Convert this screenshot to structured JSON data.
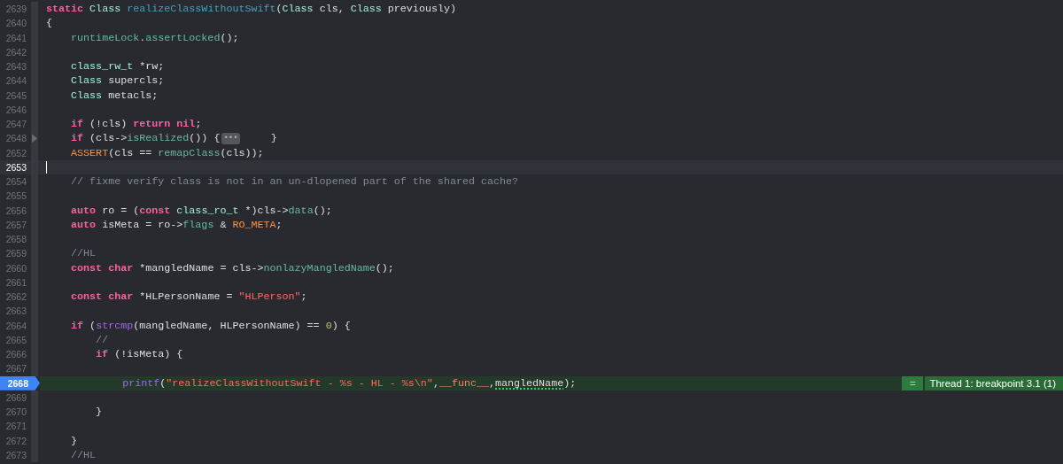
{
  "lines": [
    {
      "number": "2639",
      "current": false,
      "breakpoint": false,
      "folded": false,
      "tokens": [
        {
          "text": "static",
          "kind": "keyword"
        },
        {
          "text": " Class",
          "kind": "type"
        },
        {
          "text": " realizeClassWithoutSwift",
          "kind": "declaration"
        },
        {
          "text": "(",
          "kind": "plain"
        },
        {
          "text": "Class",
          "kind": "type"
        },
        {
          "text": " cls,",
          "kind": "plain"
        },
        {
          "text": " Class",
          "kind": "type"
        },
        {
          "text": " previously)",
          "kind": "plain"
        }
      ]
    },
    {
      "number": "2640",
      "current": false,
      "breakpoint": false,
      "folded": false,
      "tokens": [
        {
          "text": "{",
          "kind": "plain"
        }
      ]
    },
    {
      "number": "2641",
      "current": false,
      "breakpoint": false,
      "folded": false,
      "tokens": [
        {
          "text": "    runtimeLock",
          "kind": "function"
        },
        {
          "text": ".",
          "kind": "plain"
        },
        {
          "text": "assertLocked",
          "kind": "function"
        },
        {
          "text": "();",
          "kind": "plain"
        }
      ]
    },
    {
      "number": "2642",
      "current": false,
      "breakpoint": false,
      "folded": false
    },
    {
      "number": "2643",
      "current": false,
      "breakpoint": false,
      "folded": false,
      "tokens": [
        {
          "text": "    class_rw_t",
          "kind": "type"
        },
        {
          "text": " *rw;",
          "kind": "plain"
        }
      ]
    },
    {
      "number": "2644",
      "current": false,
      "breakpoint": false,
      "folded": false,
      "tokens": [
        {
          "text": "    Class",
          "kind": "type"
        },
        {
          "text": " supercls;",
          "kind": "plain"
        }
      ]
    },
    {
      "number": "2645",
      "current": false,
      "breakpoint": false,
      "folded": false,
      "tokens": [
        {
          "text": "    Class",
          "kind": "type"
        },
        {
          "text": " metacls;",
          "kind": "plain"
        }
      ]
    },
    {
      "number": "2646",
      "current": false,
      "breakpoint": false,
      "folded": false
    },
    {
      "number": "2647",
      "current": false,
      "breakpoint": false,
      "folded": false,
      "tokens": [
        {
          "text": "    if",
          "kind": "keyword"
        },
        {
          "text": " (!cls)",
          "kind": "plain"
        },
        {
          "text": " return",
          "kind": "keyword"
        },
        {
          "text": " nil",
          "kind": "keyword"
        },
        {
          "text": ";",
          "kind": "plain"
        }
      ]
    },
    {
      "number": "2648",
      "current": false,
      "breakpoint": false,
      "folded": true,
      "tokens": [
        {
          "text": "    if",
          "kind": "keyword"
        },
        {
          "text": " (cls->",
          "kind": "plain"
        },
        {
          "text": "isRealized",
          "kind": "function"
        },
        {
          "text": "()) {",
          "kind": "plain"
        },
        {
          "text": "•••",
          "kind": "fold"
        },
        {
          "text": "     }",
          "kind": "plain"
        }
      ]
    },
    {
      "number": "2652",
      "current": false,
      "breakpoint": false,
      "folded": false,
      "tokens": [
        {
          "text": "    ASSERT",
          "kind": "macro"
        },
        {
          "text": "(cls ==",
          "kind": "plain"
        },
        {
          "text": " remapClass",
          "kind": "function"
        },
        {
          "text": "(cls));",
          "kind": "plain"
        }
      ]
    },
    {
      "number": "2653",
      "current": true,
      "breakpoint": false,
      "folded": false
    },
    {
      "number": "2654",
      "current": false,
      "breakpoint": false,
      "folded": false,
      "tokens": [
        {
          "text": "    // fixme verify class is not in an un-dlopened part of the shared cache?",
          "kind": "comment"
        }
      ]
    },
    {
      "number": "2655",
      "current": false,
      "breakpoint": false,
      "folded": false
    },
    {
      "number": "2656",
      "current": false,
      "breakpoint": false,
      "folded": false,
      "tokens": [
        {
          "text": "    auto",
          "kind": "keyword"
        },
        {
          "text": " ro = (",
          "kind": "plain"
        },
        {
          "text": "const",
          "kind": "keyword"
        },
        {
          "text": " class_ro_t",
          "kind": "type"
        },
        {
          "text": " *)cls->",
          "kind": "plain"
        },
        {
          "text": "data",
          "kind": "function"
        },
        {
          "text": "();",
          "kind": "plain"
        }
      ]
    },
    {
      "number": "2657",
      "current": false,
      "breakpoint": false,
      "folded": false,
      "tokens": [
        {
          "text": "    auto",
          "kind": "keyword"
        },
        {
          "text": " isMeta = ro->",
          "kind": "plain"
        },
        {
          "text": "flags",
          "kind": "function"
        },
        {
          "text": " &",
          "kind": "plain"
        },
        {
          "text": " RO_META",
          "kind": "macro"
        },
        {
          "text": ";",
          "kind": "plain"
        }
      ]
    },
    {
      "number": "2658",
      "current": false,
      "breakpoint": false,
      "folded": false
    },
    {
      "number": "2659",
      "current": false,
      "breakpoint": false,
      "folded": false,
      "tokens": [
        {
          "text": "    //HL",
          "kind": "comment"
        }
      ]
    },
    {
      "number": "2660",
      "current": false,
      "breakpoint": false,
      "folded": false,
      "tokens": [
        {
          "text": "    const",
          "kind": "keyword"
        },
        {
          "text": " char",
          "kind": "keyword"
        },
        {
          "text": " *mangledName = cls->",
          "kind": "plain"
        },
        {
          "text": "nonlazyMangledName",
          "kind": "function"
        },
        {
          "text": "();",
          "kind": "plain"
        }
      ]
    },
    {
      "number": "2661",
      "current": false,
      "breakpoint": false,
      "folded": false
    },
    {
      "number": "2662",
      "current": false,
      "breakpoint": false,
      "folded": false,
      "tokens": [
        {
          "text": "    const",
          "kind": "keyword"
        },
        {
          "text": " char",
          "kind": "keyword"
        },
        {
          "text": " *HLPersonName =",
          "kind": "plain"
        },
        {
          "text": " \"HLPerson\"",
          "kind": "string"
        },
        {
          "text": ";",
          "kind": "plain"
        }
      ]
    },
    {
      "number": "2663",
      "current": false,
      "breakpoint": false,
      "folded": false
    },
    {
      "number": "2664",
      "current": false,
      "breakpoint": false,
      "folded": false,
      "tokens": [
        {
          "text": "    if",
          "kind": "keyword"
        },
        {
          "text": " (",
          "kind": "plain"
        },
        {
          "text": "strcmp",
          "kind": "system"
        },
        {
          "text": "(mangledName, HLPersonName) ==",
          "kind": "plain"
        },
        {
          "text": " 0",
          "kind": "number"
        },
        {
          "text": ") {",
          "kind": "plain"
        }
      ]
    },
    {
      "number": "2665",
      "current": false,
      "breakpoint": false,
      "folded": false,
      "tokens": [
        {
          "text": "        //",
          "kind": "comment"
        }
      ]
    },
    {
      "number": "2666",
      "current": false,
      "breakpoint": false,
      "folded": false,
      "tokens": [
        {
          "text": "        if",
          "kind": "keyword"
        },
        {
          "text": " (!isMeta) {",
          "kind": "plain"
        }
      ]
    },
    {
      "number": "2667",
      "current": false,
      "breakpoint": false,
      "folded": false
    },
    {
      "number": "2668",
      "current": false,
      "breakpoint": true,
      "folded": false,
      "tokens": [
        {
          "text": "            printf",
          "kind": "system"
        },
        {
          "text": "(",
          "kind": "plain"
        },
        {
          "text": "\"realizeClassWithoutSwift - %s - HL - %s\\n\"",
          "kind": "string"
        },
        {
          "text": ",",
          "kind": "plain"
        },
        {
          "text": "__func__",
          "kind": "builtin"
        },
        {
          "text": ",",
          "kind": "plain"
        },
        {
          "text": "mangledName",
          "kind": "plain",
          "underline": true
        },
        {
          "text": ");",
          "kind": "plain"
        }
      ],
      "annotation": {
        "icon": "=",
        "text": "Thread 1: breakpoint 3.1 (1)"
      }
    },
    {
      "number": "2669",
      "current": false,
      "breakpoint": false,
      "folded": false
    },
    {
      "number": "2670",
      "current": false,
      "breakpoint": false,
      "folded": false,
      "tokens": [
        {
          "text": "        }",
          "kind": "plain"
        }
      ]
    },
    {
      "number": "2671",
      "current": false,
      "breakpoint": false,
      "folded": false
    },
    {
      "number": "2672",
      "current": false,
      "breakpoint": false,
      "folded": false,
      "tokens": [
        {
          "text": "    }",
          "kind": "plain"
        }
      ]
    },
    {
      "number": "2673",
      "current": false,
      "breakpoint": false,
      "folded": false,
      "tokens": [
        {
          "text": "    //HL",
          "kind": "comment"
        }
      ]
    }
  ]
}
